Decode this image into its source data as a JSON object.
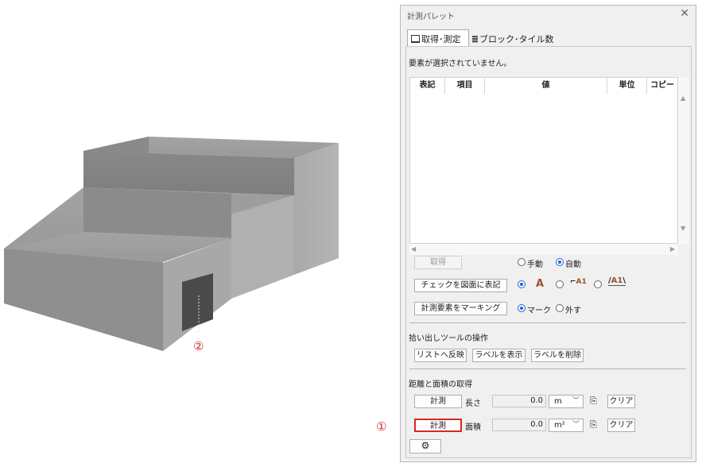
{
  "annotations": {
    "marker_1": "①",
    "marker_2": "②"
  },
  "panel": {
    "title": "計測パレット",
    "close_glyph": "✕",
    "tabs": [
      {
        "label": "取得･測定",
        "active": true
      },
      {
        "label": "ブロック･タイル数",
        "active": false
      }
    ],
    "status_message": "要素が選択されていません。",
    "table": {
      "columns": [
        "表記",
        "項目",
        "値",
        "単位",
        "コピー"
      ],
      "rows": []
    },
    "acquire_button": "取得",
    "acquire_mode": {
      "manual": "手動",
      "auto": "自動",
      "selected": "auto"
    },
    "check_button": "チェックを図面に表記",
    "text_style_glyph": "A",
    "text_style_selected": "plain",
    "mark_button": "計測要素をマーキング",
    "mark_mode": {
      "mark": "マーク",
      "unmark": "外す",
      "selected": "mark"
    },
    "pickup_section": {
      "title": "拾い出しツールの操作",
      "reflect_button": "リストへ反映",
      "show_label_button": "ラベルを表示",
      "delete_label_button": "ラベルを削除"
    },
    "distance_section": {
      "title": "距離と面積の取得",
      "length": {
        "measure_button": "計測",
        "label": "長さ",
        "value": "0.0",
        "unit": "m",
        "clear_button": "クリア"
      },
      "area": {
        "measure_button": "計測",
        "label": "面積",
        "value": "0.0",
        "unit": "m²",
        "clear_button": "クリア"
      }
    },
    "settings_icon": "gear-icon"
  },
  "colors": {
    "highlight": "#d62828",
    "radio_selected": "#1f5fd6"
  }
}
